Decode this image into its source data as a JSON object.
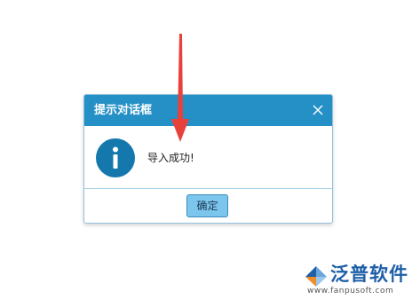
{
  "dialog": {
    "title": "提示对话框",
    "message": "导入成功!",
    "ok_label": "确定",
    "close_icon": "close-icon",
    "info_icon": "info-icon"
  },
  "annotation": {
    "arrow_color": "#e8403a"
  },
  "logo": {
    "name": "泛普软件",
    "url": "www.fanpusoft.com"
  },
  "colors": {
    "header": "#2490c6",
    "info_icon": "#1478ad",
    "ok_button": "#7cc5ec",
    "logo_text": "#1e5fa8"
  }
}
